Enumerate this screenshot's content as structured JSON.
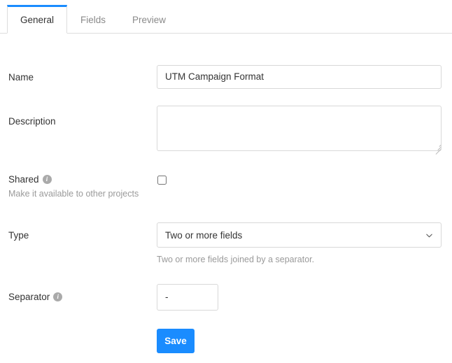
{
  "tabs": [
    {
      "label": "General",
      "active": true
    },
    {
      "label": "Fields",
      "active": false
    },
    {
      "label": "Preview",
      "active": false
    }
  ],
  "form": {
    "name": {
      "label": "Name",
      "value": "UTM Campaign Format",
      "placeholder": ""
    },
    "description": {
      "label": "Description",
      "value": "",
      "placeholder": ""
    },
    "shared": {
      "label": "Shared",
      "info_icon": "info-icon",
      "sublabel": "Make it available to other projects",
      "checked": false
    },
    "type": {
      "label": "Type",
      "selected": "Two or more fields",
      "helper": "Two or more fields joined by a separator.",
      "chevron_icon": "chevron-down-icon"
    },
    "separator": {
      "label": "Separator",
      "info_icon": "info-icon",
      "value": "-",
      "placeholder": ""
    },
    "save_label": "Save"
  },
  "colors": {
    "accent": "#1a8cff",
    "border": "#d8d8d8",
    "text": "#333333",
    "muted": "#9a9a9a"
  }
}
